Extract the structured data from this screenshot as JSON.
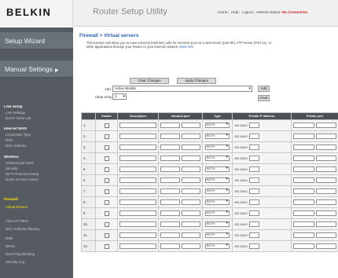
{
  "header": {
    "logo": "BELKIN",
    "app_title": "Router Setup Utility",
    "links": [
      "Home",
      "Help",
      "Logout"
    ],
    "internet_status_label": "Internet Status:",
    "internet_status_value": "No Connection"
  },
  "sidebar": {
    "setup_wizard": "Setup Wizard",
    "manual_settings": "Manual Settings",
    "sections": [
      {
        "title": "LAN Setup",
        "items": [
          "LAN Settings",
          "DHCP Client List"
        ]
      },
      {
        "title": "Internet WAN",
        "items": [
          "Connection Type",
          "DNS",
          "MAC Address"
        ]
      },
      {
        "title": "Wireless",
        "items": [
          "Channel and SSID",
          "Security",
          "Wi-Fi Protected Setup",
          "Guest Access Control"
        ]
      },
      {
        "title": "Firewall",
        "items": [
          "Virtual Servers",
          "Client IP Filters",
          "MAC Address Filtering",
          "DMZ",
          "DDNS",
          "WAN Ping Blocking",
          "Security Log"
        ]
      }
    ]
  },
  "main": {
    "title": "Firewall > Virtual servers",
    "description": "This function will allow you to route external (Internet) calls for services such as a web server (port 80), FTP server (Port 21), or other applications through your Router to your internal network.",
    "more_info": "More Info",
    "clear_changes": "Clear Changes",
    "apply_changes": "Apply Changes",
    "add_label": "Add",
    "add_value": "Active Worlds",
    "add_button": "Add",
    "clear_entry_label": "Clear entry",
    "clear_entry_value": "1",
    "clear_button": "Clear",
    "columns": [
      "",
      "Enable",
      "Description",
      "Inbound port",
      "Type",
      "Private IP address",
      "Private port"
    ],
    "rows": [
      {
        "num": "1.",
        "type": "BOTH",
        "ip_prefix": "192.168.2."
      },
      {
        "num": "2.",
        "type": "BOTH",
        "ip_prefix": "192.168.2."
      },
      {
        "num": "3.",
        "type": "BOTH",
        "ip_prefix": "192.168.2."
      },
      {
        "num": "4.",
        "type": "BOTH",
        "ip_prefix": "192.168.2."
      },
      {
        "num": "5.",
        "type": "BOTH",
        "ip_prefix": "192.168.2."
      },
      {
        "num": "6.",
        "type": "BOTH",
        "ip_prefix": "192.168.2."
      },
      {
        "num": "7.",
        "type": "BOTH",
        "ip_prefix": "192.168.2."
      },
      {
        "num": "8.",
        "type": "BOTH",
        "ip_prefix": "192.168.2."
      },
      {
        "num": "9.",
        "type": "BOTH",
        "ip_prefix": "192.168.2."
      },
      {
        "num": "10.",
        "type": "BOTH",
        "ip_prefix": "192.168.2."
      },
      {
        "num": "11.",
        "type": "BOTH",
        "ip_prefix": "192.168.2."
      },
      {
        "num": "12.",
        "type": "BOTH",
        "ip_prefix": "192.168.2."
      }
    ]
  }
}
